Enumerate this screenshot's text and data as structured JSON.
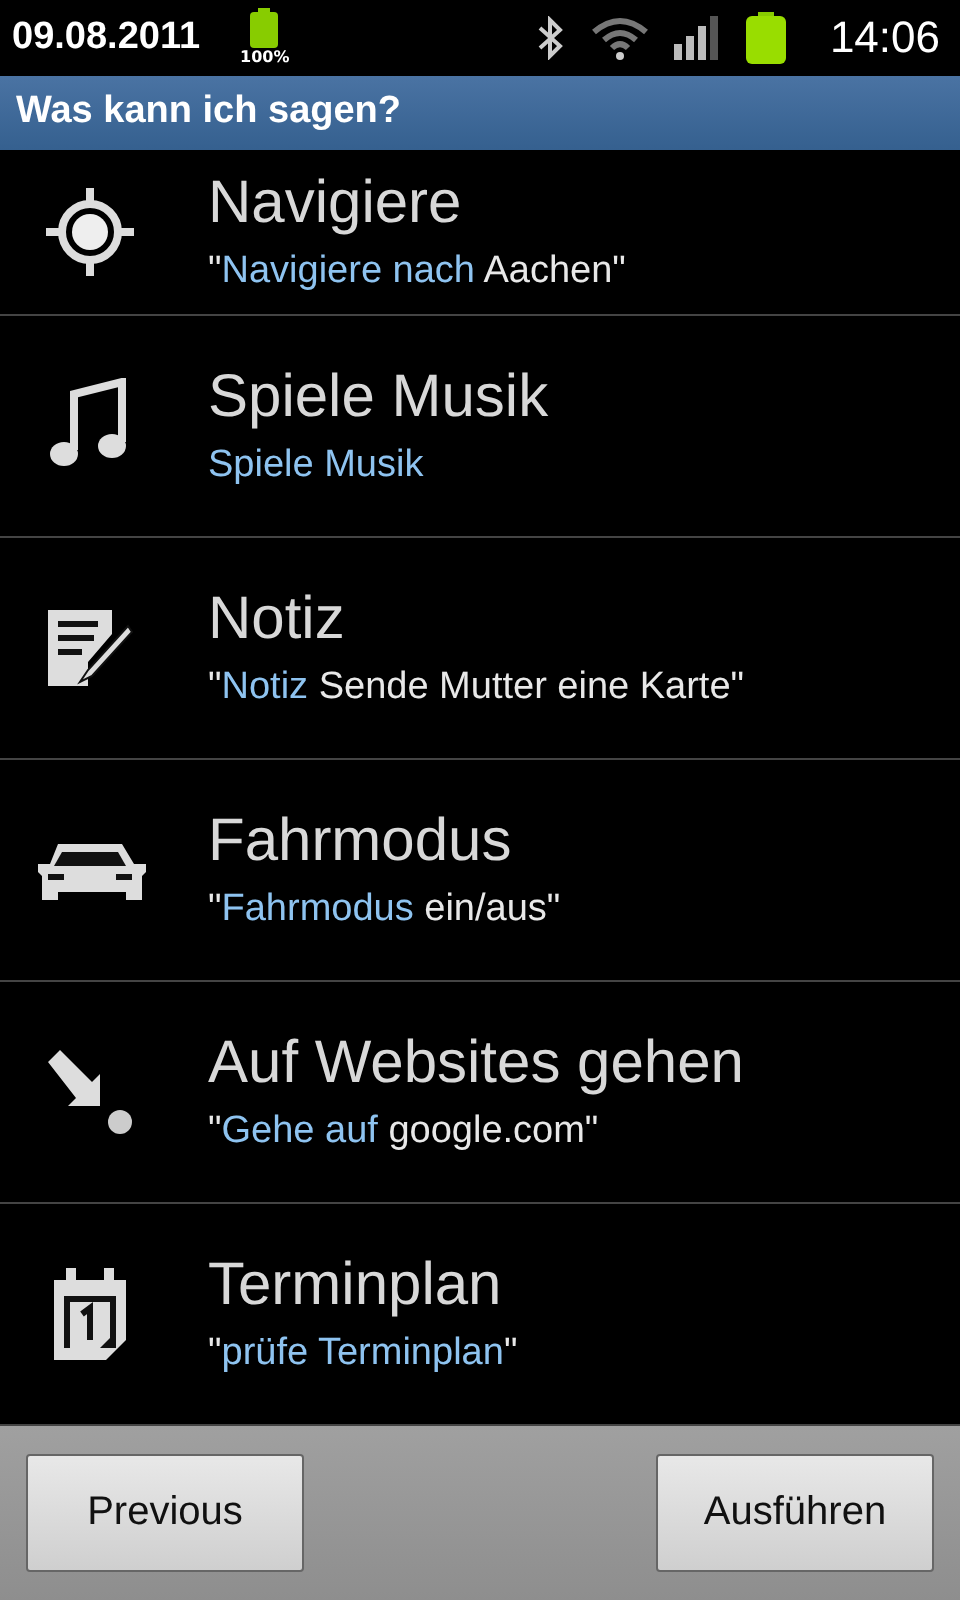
{
  "status_bar": {
    "date": "09.08.2011",
    "battery_label": "100%",
    "time": "14:06"
  },
  "title_bar": {
    "title": "Was kann ich sagen?"
  },
  "commands": [
    {
      "title": "Navigiere",
      "example": [
        {
          "text": "\"",
          "highlight": false
        },
        {
          "text": "Navigiere nach",
          "highlight": true
        },
        {
          "text": " Aachen\"",
          "highlight": false
        }
      ]
    },
    {
      "title": "Spiele Musik",
      "example": [
        {
          "text": "Spiele Musik",
          "highlight": true
        }
      ]
    },
    {
      "title": "Notiz",
      "example": [
        {
          "text": "\"",
          "highlight": false
        },
        {
          "text": "Notiz",
          "highlight": true
        },
        {
          "text": " Sende Mutter eine Karte\"",
          "highlight": false
        }
      ]
    },
    {
      "title": "Fahrmodus",
      "example": [
        {
          "text": "\"",
          "highlight": false
        },
        {
          "text": "Fahrmodus",
          "highlight": true
        },
        {
          "text": " ein/aus\"",
          "highlight": false
        }
      ]
    },
    {
      "title": "Auf Websites gehen",
      "example": [
        {
          "text": "\"",
          "highlight": false
        },
        {
          "text": "Gehe auf",
          "highlight": true
        },
        {
          "text": " google.com\"",
          "highlight": false
        }
      ]
    },
    {
      "title": "Terminplan",
      "example": [
        {
          "text": "\"",
          "highlight": false
        },
        {
          "text": "prüfe Terminplan",
          "highlight": true
        },
        {
          "text": "\"",
          "highlight": false
        }
      ]
    }
  ],
  "buttons": [
    "Previous",
    "Ausführen"
  ]
}
